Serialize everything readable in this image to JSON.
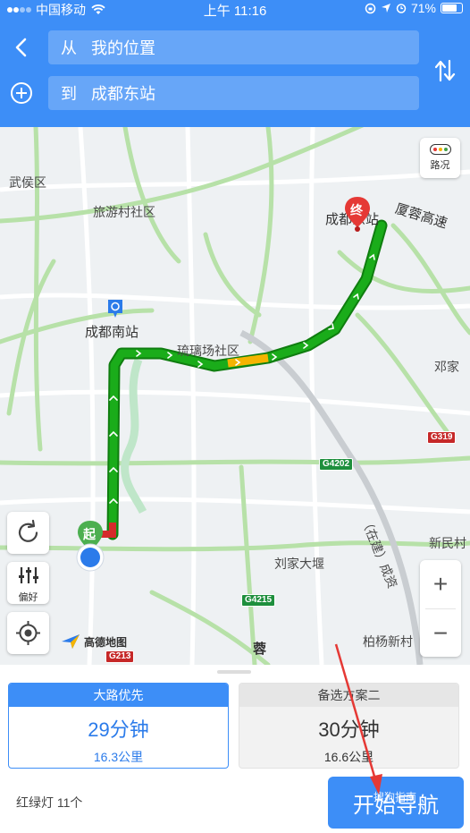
{
  "status_bar": {
    "carrier": "中国移动",
    "time": "上午 11:16",
    "battery": "71%",
    "battery_level": 0.71
  },
  "search": {
    "from_prefix": "从",
    "from_value": "我的位置",
    "to_prefix": "到",
    "to_value": "成都东站"
  },
  "map": {
    "traffic_label": "路况",
    "preference_label": "偏好",
    "logo_text": "高德地图",
    "start_marker": "起",
    "end_marker": "终",
    "places": {
      "wuhou": "武侯区",
      "lvyoucun": "旅游村社区",
      "chengdu_east": "成都东站",
      "xiarong": "厦蓉高速",
      "chengdu_south": "成都南站",
      "liulichang": "琉璃场社区",
      "dengjia": "邓家",
      "xinmin": "新民村",
      "liujia": "刘家大堰",
      "zaijian": "（在建）成资",
      "baiyang": "柏杨新村",
      "rong": "蓉"
    },
    "highways": {
      "g319": "G319",
      "g4202": "G4202",
      "g4215": "G4215",
      "g213": "G213"
    },
    "colors": {
      "route": "#1aac1a",
      "congestion": "#f5b400",
      "brand": "#3d8ef7"
    }
  },
  "routes": [
    {
      "title": "大路优先",
      "time": "29分钟",
      "distance": "16.3公里",
      "selected": true
    },
    {
      "title": "备选方案二",
      "time": "30分钟",
      "distance": "16.6公里",
      "selected": false
    }
  ],
  "footer": {
    "traffic_lights": "红绿灯 11个",
    "start_nav": "开始导航",
    "watermark": "搜狗指南"
  }
}
